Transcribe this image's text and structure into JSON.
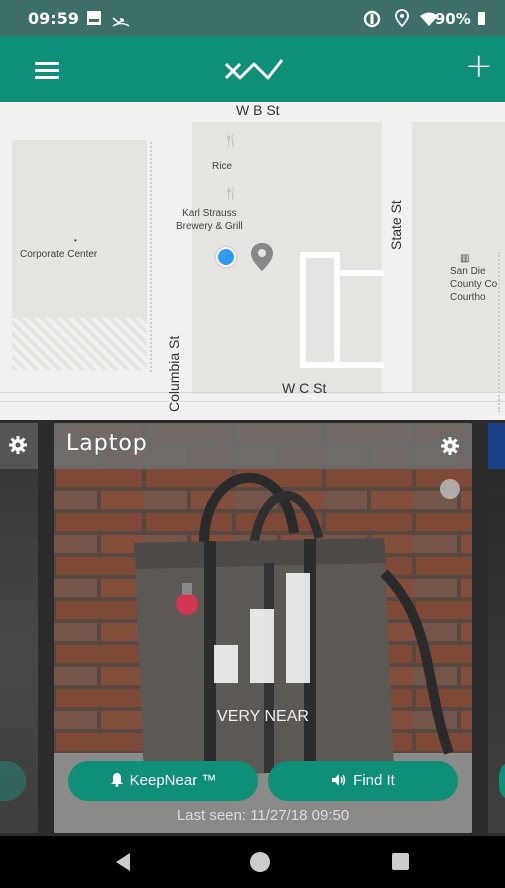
{
  "status_bar": {
    "time": "09:59",
    "battery": "90%"
  },
  "app_bar": {
    "menu_icon": "hamburger-icon",
    "logo": "xy-logo",
    "add_icon": "plus-icon"
  },
  "map": {
    "streets": {
      "top": "W B St",
      "bottom": "W C St",
      "left_vertical": "Columbia St",
      "right_vertical": "State St"
    },
    "places": [
      {
        "label": "Rice"
      },
      {
        "label": "Karl Strauss\nBrewery & Grill"
      },
      {
        "label": "Corporate Center"
      },
      {
        "label": "San Die\nCounty Co\nCourtho"
      }
    ]
  },
  "card": {
    "title": "Laptop",
    "proximity": "VERY NEAR",
    "keepnear_label": "KeepNear ™",
    "findit_label": "Find It",
    "last_seen": "Last seen: 11/27/18 09:50"
  },
  "colors": {
    "brand": "#0f8e78",
    "status_bar": "#3d6f68",
    "header_overlay": "#6e6e6e"
  }
}
